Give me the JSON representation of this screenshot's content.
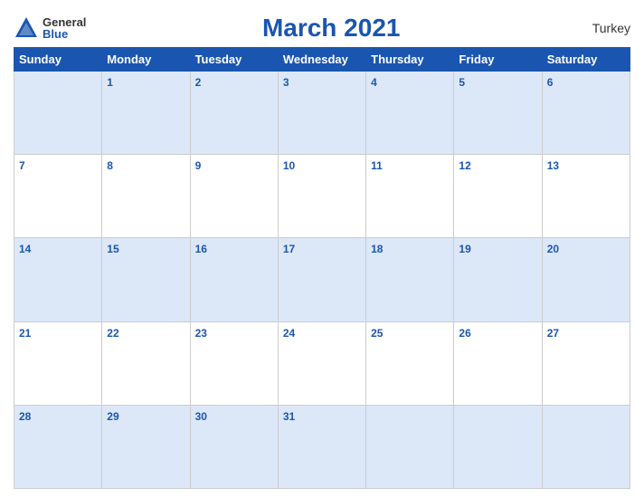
{
  "header": {
    "logo_general": "General",
    "logo_blue": "Blue",
    "title": "March 2021",
    "country": "Turkey"
  },
  "weekdays": [
    "Sunday",
    "Monday",
    "Tuesday",
    "Wednesday",
    "Thursday",
    "Friday",
    "Saturday"
  ],
  "weeks": [
    [
      {
        "day": "",
        "empty": true
      },
      {
        "day": "1"
      },
      {
        "day": "2"
      },
      {
        "day": "3"
      },
      {
        "day": "4"
      },
      {
        "day": "5"
      },
      {
        "day": "6"
      }
    ],
    [
      {
        "day": "7"
      },
      {
        "day": "8"
      },
      {
        "day": "9"
      },
      {
        "day": "10"
      },
      {
        "day": "11"
      },
      {
        "day": "12"
      },
      {
        "day": "13"
      }
    ],
    [
      {
        "day": "14"
      },
      {
        "day": "15"
      },
      {
        "day": "16"
      },
      {
        "day": "17"
      },
      {
        "day": "18"
      },
      {
        "day": "19"
      },
      {
        "day": "20"
      }
    ],
    [
      {
        "day": "21"
      },
      {
        "day": "22"
      },
      {
        "day": "23"
      },
      {
        "day": "24"
      },
      {
        "day": "25"
      },
      {
        "day": "26"
      },
      {
        "day": "27"
      }
    ],
    [
      {
        "day": "28"
      },
      {
        "day": "29"
      },
      {
        "day": "30"
      },
      {
        "day": "31"
      },
      {
        "day": "",
        "empty": true
      },
      {
        "day": "",
        "empty": true
      },
      {
        "day": "",
        "empty": true
      }
    ]
  ]
}
